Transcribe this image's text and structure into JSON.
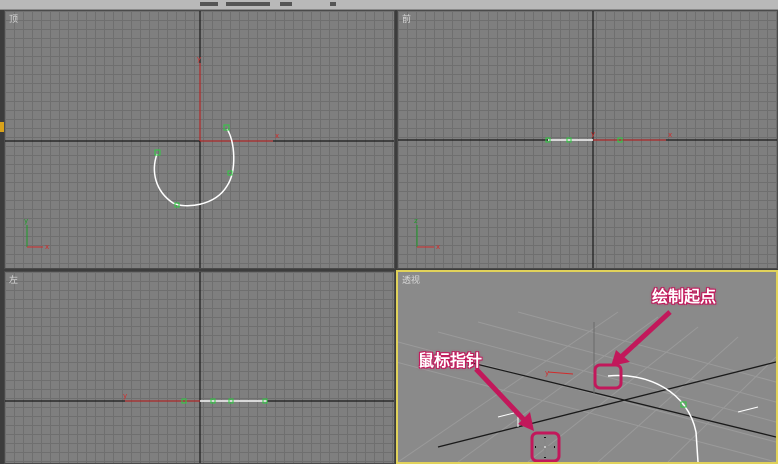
{
  "viewports": {
    "top": {
      "label": "顶"
    },
    "front": {
      "label": "前"
    },
    "left": {
      "label": "左"
    },
    "perspective": {
      "label": "透视"
    }
  },
  "axes": {
    "x": "x",
    "y": "y",
    "z": "z"
  },
  "annotations": {
    "draw_start": "绘制起点",
    "mouse_pointer": "鼠标指针"
  },
  "colors": {
    "accent": "#c2185b",
    "active_viewport_border": "#e1d25a",
    "spline": "#ffffff",
    "vertex": "#2ecc40",
    "axis_x": "#d12b2b",
    "axis_y": "#1e9e2a"
  }
}
